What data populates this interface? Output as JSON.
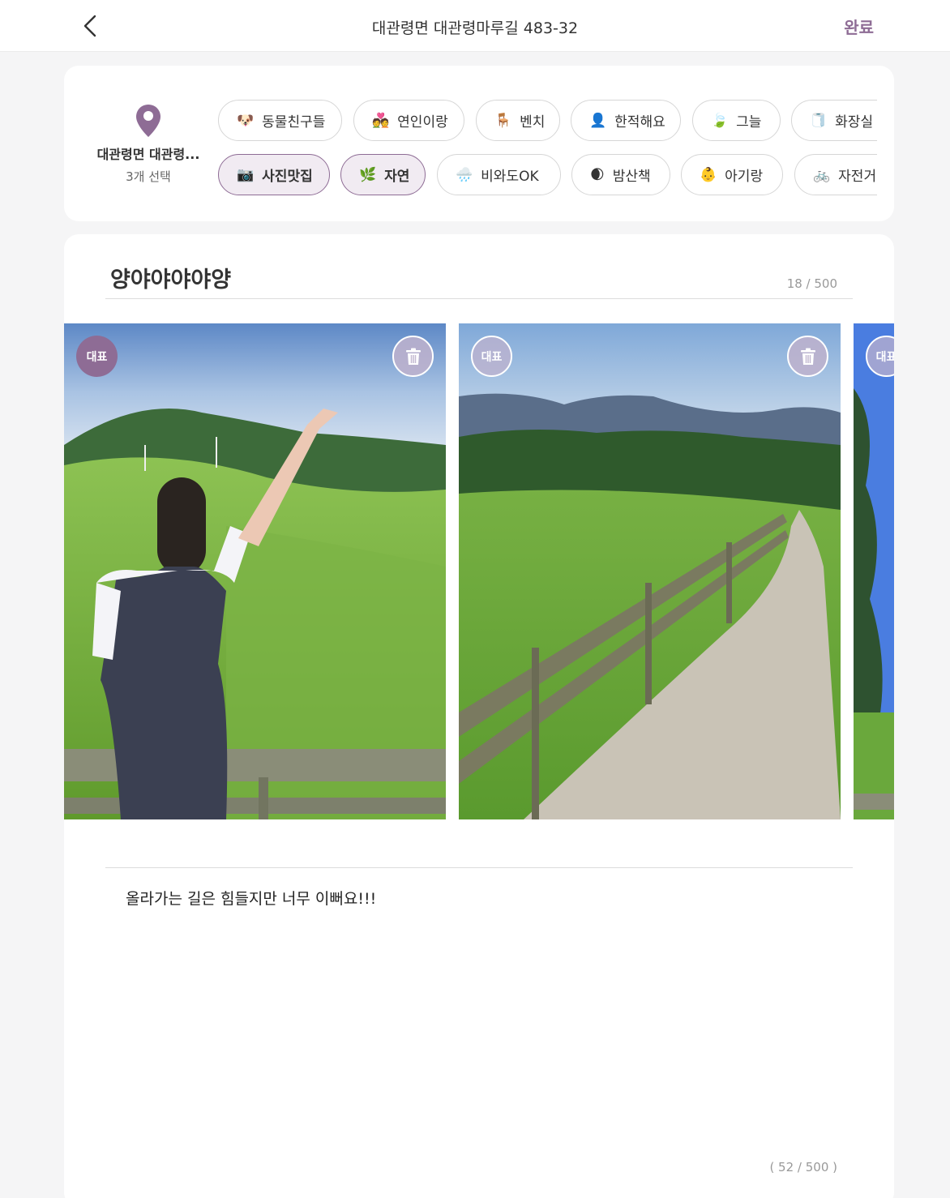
{
  "header": {
    "title": "대관령면 대관령마루길 483-32",
    "done_label": "완료"
  },
  "location": {
    "name": "대관령면 대관령...",
    "selected_count": "3개 선택"
  },
  "tags_row1": [
    {
      "emoji": "🐶",
      "label": "동물친구들",
      "selected": true
    },
    {
      "emoji": "💑",
      "label": "연인이랑",
      "selected": false
    },
    {
      "emoji": "🪑",
      "label": "벤치",
      "selected": false
    },
    {
      "emoji": "👤",
      "label": "한적해요",
      "selected": false
    },
    {
      "emoji": "🍃",
      "label": "그늘",
      "selected": false
    },
    {
      "emoji": "🧻",
      "label": "화장실",
      "selected": false
    }
  ],
  "tags_row2": [
    {
      "emoji": "📷",
      "label": "사진맛집",
      "selected": true
    },
    {
      "emoji": "🌿",
      "label": "자연",
      "selected": true
    },
    {
      "emoji": "🌧️",
      "label": "비와도OK",
      "selected": false
    },
    {
      "emoji": "🌒",
      "label": "밤산책",
      "selected": false
    },
    {
      "emoji": "👶",
      "label": "아기랑",
      "selected": false
    },
    {
      "emoji": "🚲",
      "label": "자전거",
      "selected": false
    }
  ],
  "post": {
    "title": "양야야야야양",
    "title_count": "18 / 500",
    "body": "올라가는 길은 힘들지만 너무 이뻐요!!!",
    "body_count": "( 52 / 500 )"
  },
  "photos": [
    {
      "badge": "대표",
      "representative": true
    },
    {
      "badge": "대표",
      "representative": false
    },
    {
      "badge": "대표",
      "representative": false
    }
  ],
  "colors": {
    "accent": "#8e6c95",
    "accent_light": "#f1ebf2"
  },
  "icons": {
    "back": "chevron-left-icon",
    "location": "map-pin-icon",
    "delete": "trash-icon"
  }
}
